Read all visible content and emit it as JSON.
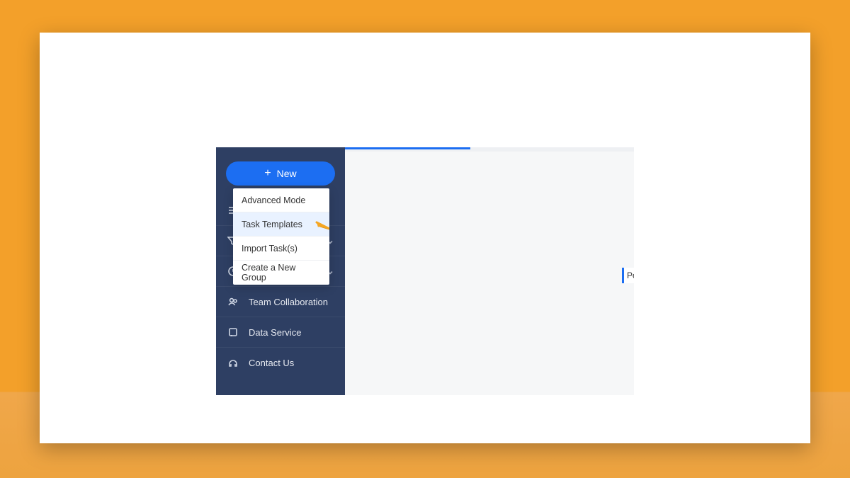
{
  "new_button": {
    "label": "New"
  },
  "dropdown": {
    "items": [
      {
        "label": "Advanced Mode"
      },
      {
        "label": "Task Templates",
        "highlighted": true
      },
      {
        "label": "Import Task(s)",
        "chevron": true
      },
      {
        "label": "Create a New Group",
        "chevron": true
      }
    ]
  },
  "sidebar": {
    "items": [
      {
        "label": "Team Collaboration"
      },
      {
        "label": "Data Service"
      },
      {
        "label": "Contact Us"
      }
    ]
  },
  "right_tag": {
    "label": "Po"
  }
}
